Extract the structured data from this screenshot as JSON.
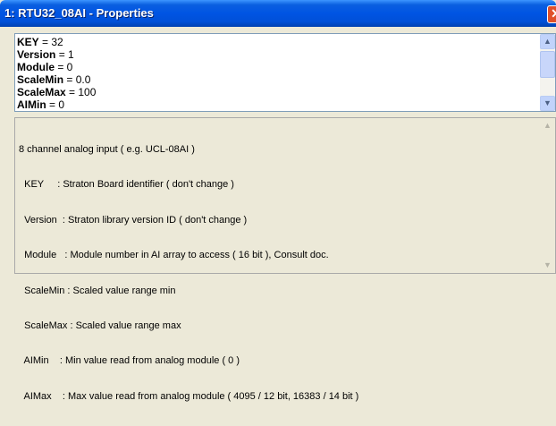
{
  "window": {
    "title": "1: RTU32_08AI - Properties",
    "close_glyph": "✕"
  },
  "properties": [
    {
      "key": "KEY",
      "value": " = 32"
    },
    {
      "key": "Version",
      "value": " = 1"
    },
    {
      "key": "Module",
      "value": " = 0"
    },
    {
      "key": "ScaleMin",
      "value": " = 0.0"
    },
    {
      "key": "ScaleMax",
      "value": " = 100"
    },
    {
      "key": "AIMin",
      "value": " = 0"
    }
  ],
  "description": [
    "8 channel analog input ( e.g. UCL-08AI )",
    "  KEY     : Straton Board identifier ( don't change )",
    "  Version  : Straton library version ID ( don't change )",
    "  Module   : Module number in AI array to access ( 16 bit ), Consult doc.",
    "  ScaleMin : Scaled value range min",
    "  ScaleMax : Scaled value range max",
    "  AIMin    : Min value read from analog module ( 0 )",
    "  AIMax    : Max value read from analog module ( 4095 / 12 bit, 16383 / 14 bit )"
  ],
  "scrollbar": {
    "up_glyph": "▲",
    "down_glyph": "▼"
  }
}
